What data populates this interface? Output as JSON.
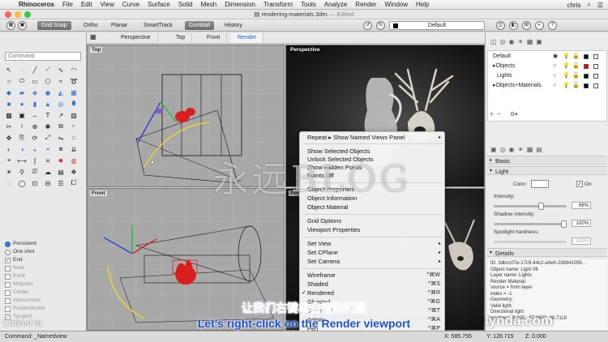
{
  "menubar": {
    "app": "Rhinoceros",
    "items": [
      "File",
      "Edit",
      "View",
      "Curve",
      "Surface",
      "Solid",
      "Mesh",
      "Dimension",
      "Transform",
      "Tools",
      "Analyze",
      "Render",
      "Window",
      "Help"
    ],
    "user": "chris"
  },
  "window": {
    "title": "rendering-materials.3dm",
    "state": "— Edited"
  },
  "toolbar": {
    "grid_snap": "Grid Snap",
    "ortho": "Ortho",
    "planar": "Planar",
    "smarttrack": "SmartTrack",
    "gumball": "Gumball",
    "history": "History",
    "layer": "Default"
  },
  "viewport_tabs": [
    "Perspective",
    "Top",
    "Front",
    "Render"
  ],
  "viewports": {
    "top": "Top",
    "perspective": "Perspective",
    "front": "Front",
    "render": "Render"
  },
  "command": {
    "placeholder": "Command"
  },
  "osnap": {
    "persistent": "Persistent",
    "one_shot": "One shot",
    "items": [
      "End",
      "Near",
      "Point",
      "Midpoint",
      "Center",
      "Intersection",
      "Perpendicular",
      "Tangent"
    ]
  },
  "context_menu": {
    "repeat": "Repeat",
    "repeat_cmd": "Show Named Views Panel",
    "show_selected": "Show Selected Objects",
    "unlock_selected": "Unlock Selected Objects",
    "show_hidden_points": "Show Hidden Points",
    "points_off": "Points Off",
    "object_properties": "Object Properties",
    "object_information": "Object Information",
    "object_material": "Object Material",
    "grid_options": "Grid Options",
    "viewport_properties": "Viewport Properties",
    "set_view": "Set View",
    "set_cplane": "Set CPlane",
    "set_camera": "Set Camera",
    "wireframe": "Wireframe",
    "wireframe_sc": "^⌘W",
    "shaded": "Shaded",
    "shaded_sc": "^⌘S",
    "rendered": "Rendered",
    "rendered_sc": "^⌘R",
    "ghosted": "Ghosted",
    "ghosted_sc": "^⌘G",
    "technical": "Technical",
    "technical_sc": "^⌘T",
    "artistic": "Artistic",
    "artistic_sc": "^⌘A",
    "pen": "Pen",
    "pen_sc": "^⌘P"
  },
  "layers": [
    {
      "name": "Default",
      "color": "#000000"
    },
    {
      "name": "Objects",
      "color": "#ff0000"
    },
    {
      "name": "Lights",
      "color": "#000000"
    },
    {
      "name": "Objects+Materials",
      "color": "#000000"
    }
  ],
  "properties": {
    "basic": "Basic",
    "light": "Light",
    "color_label": "Color:",
    "on_label": "On",
    "intensity_label": "Intensity:",
    "intensity_value": "66%",
    "intensity_level": 0.66,
    "shadow_label": "Shadow intensity:",
    "shadow_value": "100%",
    "shadow_level": 1.0,
    "spotlight_label": "Spotlight hardness:",
    "spotlight_value": "100%",
    "details": "Details",
    "detail_lines": [
      "ID: 3dbcc07e-17c9-44c2-a0e6-238841059…",
      "Object name: Light 06",
      "Layer name: Lights",
      "Render Material:",
      "  source = from layer",
      "  index = -1",
      "Geometry:",
      "  Valid light.",
      "  Directional light",
      "  location: 59.935, -57.9652, 38.7119"
    ]
  },
  "status": {
    "command": "Command: _Namedview",
    "x": "X: 585.755",
    "y": "Y: 128.715",
    "z": "Z: 0.000"
  },
  "overlay": {
    "watermark": "永远BLOG",
    "subtitle_cn": "让我们右键单击渲染视图",
    "subtitle_en": "Let's right-click on the Render viewport",
    "lynda": "lynda.com",
    "linkedin": "Linked in"
  }
}
